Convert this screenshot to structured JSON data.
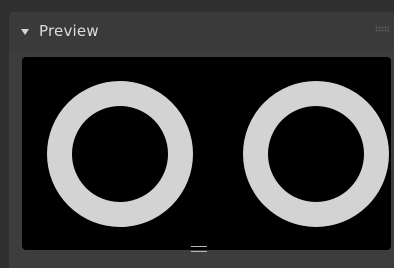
{
  "panel": {
    "title": "Preview",
    "collapse_icon": "triangle-down-icon",
    "grip_icon": "drag-grip-icon",
    "preview": {
      "background_color": "#000000",
      "ring_color": "#d3d3d3"
    },
    "resize_handle_icon": "resize-handle-icon"
  }
}
